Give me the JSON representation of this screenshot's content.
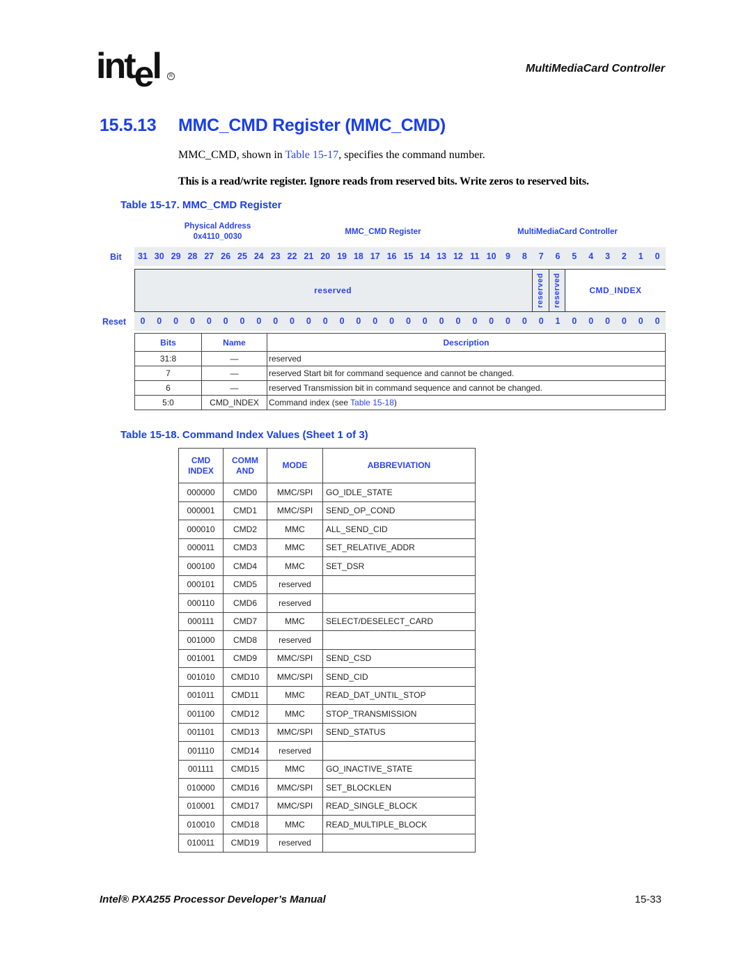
{
  "header": {
    "logo_text": "int",
    "logo_e": "e",
    "logo_l": "l",
    "logo_reg": "R",
    "section": "MultiMediaCard Controller"
  },
  "title": {
    "number": "15.5.13",
    "text": "MMC_CMD Register (MMC_CMD)"
  },
  "intro": {
    "pre": "MMC_CMD, shown in ",
    "link": "Table 15-17",
    "post": ", specifies the command number.",
    "note": "This is a read/write register. Ignore reads from reserved bits. Write zeros to reserved bits."
  },
  "table17": {
    "caption": "Table 15-17. MMC_CMD Register",
    "physical_address_label": "Physical Address",
    "physical_address": "0x4110_0030",
    "register_name": "MMC_CMD Register",
    "unit": "MultiMediaCard Controller",
    "bit_label": "Bit",
    "reset_label": "Reset",
    "bits": [
      "31",
      "30",
      "29",
      "28",
      "27",
      "26",
      "25",
      "24",
      "23",
      "22",
      "21",
      "20",
      "19",
      "18",
      "17",
      "16",
      "15",
      "14",
      "13",
      "12",
      "11",
      "10",
      "9",
      "8",
      "7",
      "6",
      "5",
      "4",
      "3",
      "2",
      "1",
      "0"
    ],
    "reset": [
      "0",
      "0",
      "0",
      "0",
      "0",
      "0",
      "0",
      "0",
      "0",
      "0",
      "0",
      "0",
      "0",
      "0",
      "0",
      "0",
      "0",
      "0",
      "0",
      "0",
      "0",
      "0",
      "0",
      "0",
      "0",
      "1",
      "0",
      "0",
      "0",
      "0",
      "0",
      "0"
    ],
    "fields": [
      {
        "label": "reserved",
        "msb": 31,
        "lsb": 8,
        "vertical": false
      },
      {
        "label": "reserved",
        "msb": 7,
        "lsb": 7,
        "vertical": true
      },
      {
        "label": "reserved",
        "msb": 6,
        "lsb": 6,
        "vertical": true
      },
      {
        "label": "CMD_INDEX",
        "msb": 5,
        "lsb": 0,
        "vertical": false
      }
    ],
    "columns": [
      "Bits",
      "Name",
      "Description"
    ],
    "rows": [
      {
        "bits": "31:8",
        "name": "—",
        "desc": "reserved",
        "link": "",
        "post": ""
      },
      {
        "bits": "7",
        "name": "—",
        "desc": "reserved Start bit for command sequence and cannot be changed.",
        "link": "",
        "post": ""
      },
      {
        "bits": "6",
        "name": "—",
        "desc": "reserved Transmission bit in command sequence and cannot be changed.",
        "link": "",
        "post": ""
      },
      {
        "bits": "5:0",
        "name": "CMD_INDEX",
        "desc": "Command index (see ",
        "link": "Table 15-18",
        "post": ")"
      }
    ]
  },
  "table18": {
    "caption": "Table 15-18. Command Index Values (Sheet 1 of 3)",
    "columns": [
      "CMD INDEX",
      "COMM AND",
      "MODE",
      "ABBREVIATION"
    ],
    "column_lines": [
      [
        "CMD",
        "INDEX"
      ],
      [
        "COMM",
        "AND"
      ],
      [
        "MODE"
      ],
      [
        "ABBREVIATION"
      ]
    ],
    "rows": [
      [
        "000000",
        "CMD0",
        "MMC/SPI",
        "GO_IDLE_STATE"
      ],
      [
        "000001",
        "CMD1",
        "MMC/SPI",
        "SEND_OP_COND"
      ],
      [
        "000010",
        "CMD2",
        "MMC",
        "ALL_SEND_CID"
      ],
      [
        "000011",
        "CMD3",
        "MMC",
        "SET_RELATIVE_ADDR"
      ],
      [
        "000100",
        "CMD4",
        "MMC",
        "SET_DSR"
      ],
      [
        "000101",
        "CMD5",
        "reserved",
        ""
      ],
      [
        "000110",
        "CMD6",
        "reserved",
        ""
      ],
      [
        "000111",
        "CMD7",
        "MMC",
        "SELECT/DESELECT_CARD"
      ],
      [
        "001000",
        "CMD8",
        "reserved",
        ""
      ],
      [
        "001001",
        "CMD9",
        "MMC/SPI",
        "SEND_CSD"
      ],
      [
        "001010",
        "CMD10",
        "MMC/SPI",
        "SEND_CID"
      ],
      [
        "001011",
        "CMD11",
        "MMC",
        "READ_DAT_UNTIL_STOP"
      ],
      [
        "001100",
        "CMD12",
        "MMC",
        "STOP_TRANSMISSION"
      ],
      [
        "001101",
        "CMD13",
        "MMC/SPI",
        "SEND_STATUS"
      ],
      [
        "001110",
        "CMD14",
        "reserved",
        ""
      ],
      [
        "001111",
        "CMD15",
        "MMC",
        "GO_INACTIVE_STATE"
      ],
      [
        "010000",
        "CMD16",
        "MMC/SPI",
        "SET_BLOCKLEN"
      ],
      [
        "010001",
        "CMD17",
        "MMC/SPI",
        "READ_SINGLE_BLOCK"
      ],
      [
        "010010",
        "CMD18",
        "MMC",
        "READ_MULTIPLE_BLOCK"
      ],
      [
        "010011",
        "CMD19",
        "reserved",
        ""
      ]
    ]
  },
  "footer": {
    "title": "Intel® PXA255 Processor Developer’s Manual",
    "page": "15-33"
  }
}
